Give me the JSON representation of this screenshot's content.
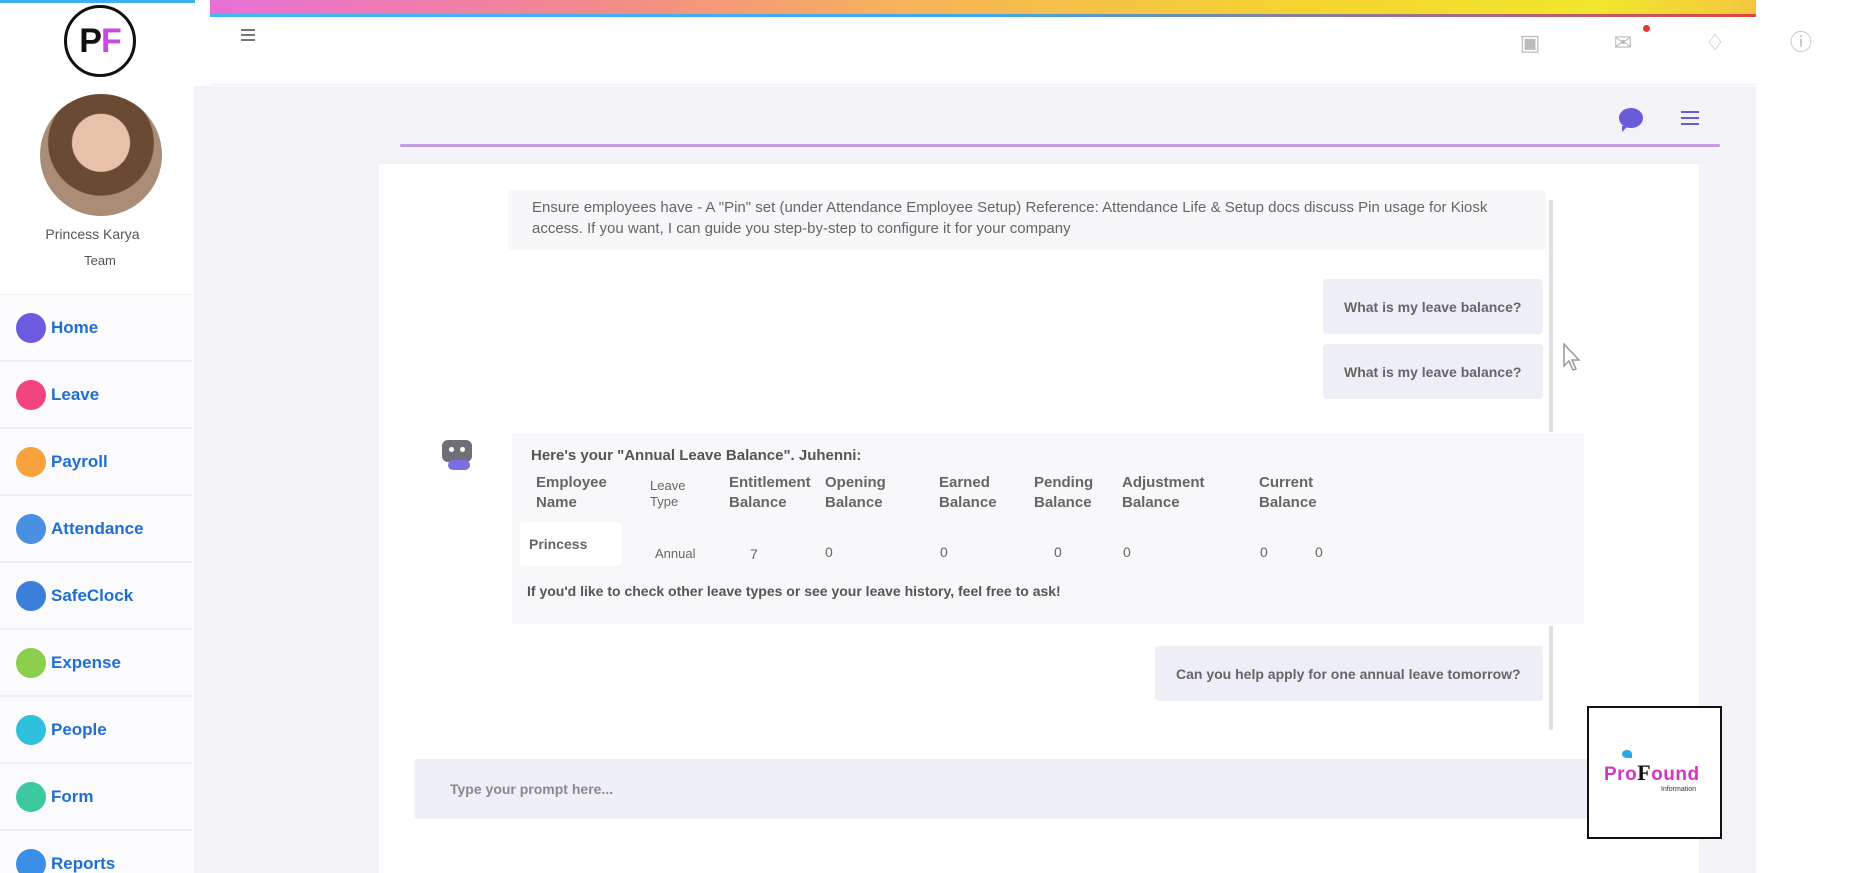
{
  "app": {
    "logo_letters": [
      "P",
      "F"
    ]
  },
  "user": {
    "name": "Princess Karya",
    "role": "Team"
  },
  "sidebar": {
    "items": [
      {
        "label": "Home",
        "icon": "home-icon",
        "color": "#6b5be0"
      },
      {
        "label": "Leave",
        "icon": "leave-icon",
        "color": "#f0457f"
      },
      {
        "label": "Payroll",
        "icon": "payroll-icon",
        "color": "#f7a23c"
      },
      {
        "label": "Attendance",
        "icon": "attendance-icon",
        "color": "#4a8fe0"
      },
      {
        "label": "SafeClock",
        "icon": "safeclock-icon",
        "color": "#3b7fdb"
      },
      {
        "label": "Expense",
        "icon": "expense-icon",
        "color": "#8ccf4d"
      },
      {
        "label": "People",
        "icon": "people-icon",
        "color": "#2fc0dd"
      },
      {
        "label": "Form",
        "icon": "form-icon",
        "color": "#3cc9a0"
      },
      {
        "label": "Reports",
        "icon": "reports-icon",
        "color": "#3c8ee6"
      }
    ]
  },
  "header": {
    "icons": [
      "bot-icon",
      "mail-icon",
      "bell-icon",
      "help-icon"
    ],
    "mail_unread": true
  },
  "chat": {
    "bot_message_top": "Ensure employees have - A \"Pin\" set (under Attendance Employee Setup) Reference: Attendance Life & Setup docs discuss Pin usage for Kiosk access.  If you want, I can guide you step-by-step to configure it for your company",
    "user_message_1": "What is my leave balance?",
    "user_message_2": "What is my leave balance?",
    "bot_intro": "Here's your \"Annual Leave Balance\". Juhenni:",
    "table": {
      "headers": {
        "employee_name": "Employee Name",
        "leave_type": "Leave Type",
        "entitlement": "Entitlement Balance",
        "opening": "Opening Balance",
        "earned": "Earned Balance",
        "pending": "Pending Balance",
        "adjustment": "Adjustment Balance",
        "current": "Current Balance"
      },
      "row": {
        "employee_name": "Princess",
        "leave_type": "Annual",
        "entitlement": "7",
        "opening": "0",
        "earned": "0",
        "pending": "0",
        "adjustment": "0",
        "current": "0",
        "extra": "0"
      }
    },
    "bot_footer": "If you'd like to check other leave types or see your leave history, feel free to ask!",
    "user_message_3": "Can you help apply for one annual leave tomorrow?"
  },
  "prompt": {
    "placeholder": "Type your prompt here..."
  },
  "brand": {
    "name_part1": "Pro",
    "name_part2": "F",
    "name_part3": "ound",
    "subtitle": "Information"
  },
  "colors": {
    "accent": "#6a5bd9",
    "link": "#1f6fd0",
    "brand_pink": "#d633c8"
  }
}
